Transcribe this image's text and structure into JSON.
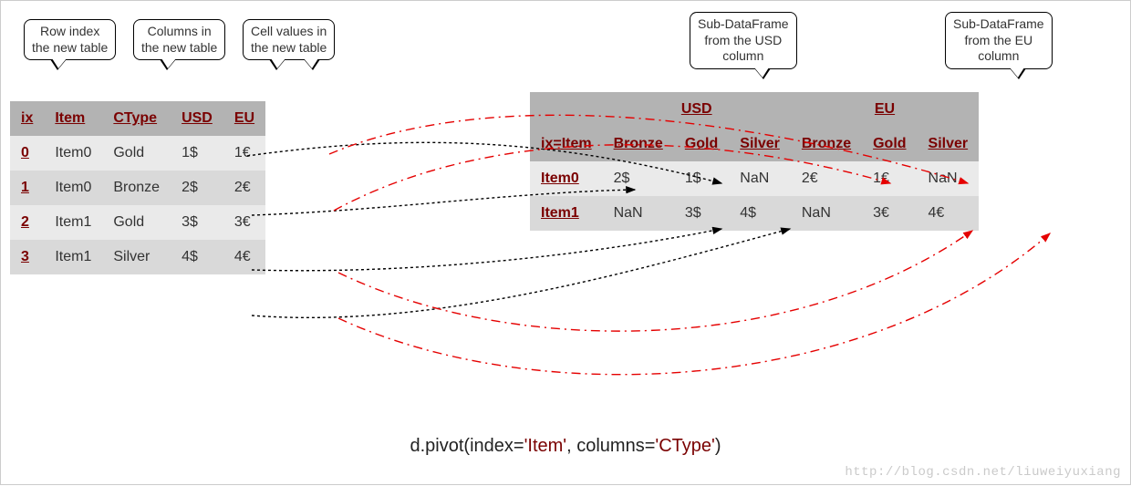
{
  "callouts": {
    "rowIndex": "Row index\nthe new table",
    "columns": "Columns in\nthe new table",
    "cellValues": "Cell values in\nthe new table",
    "subUSD": "Sub-DataFrame\nfrom the USD\ncolumn",
    "subEU": "Sub-DataFrame\nfrom the EU\ncolumn"
  },
  "leftTable": {
    "headers": [
      "ix",
      "Item",
      "CType",
      "USD",
      "EU"
    ],
    "rows": [
      {
        "ix": "0",
        "item": "Item0",
        "ctype": "Gold",
        "usd": "1$",
        "eu": "1€"
      },
      {
        "ix": "1",
        "item": "Item0",
        "ctype": "Bronze",
        "usd": "2$",
        "eu": "2€"
      },
      {
        "ix": "2",
        "item": "Item1",
        "ctype": "Gold",
        "usd": "3$",
        "eu": "3€"
      },
      {
        "ix": "3",
        "item": "Item1",
        "ctype": "Silver",
        "usd": "4$",
        "eu": "4€"
      }
    ]
  },
  "rightTable": {
    "topGroups": [
      "USD",
      "EU"
    ],
    "subHeaders": [
      "Bronze",
      "Gold",
      "Silver"
    ],
    "indexHeader": "ix=Item",
    "rows": [
      {
        "index": "Item0",
        "usd": {
          "bronze": "2$",
          "gold": "1$",
          "silver": "NaN"
        },
        "eu": {
          "bronze": "2€",
          "gold": "1€",
          "silver": "NaN"
        }
      },
      {
        "index": "Item1",
        "usd": {
          "bronze": "NaN",
          "gold": "3$",
          "silver": "4$"
        },
        "eu": {
          "bronze": "NaN",
          "gold": "3€",
          "silver": "4€"
        }
      }
    ]
  },
  "code": {
    "prefix": "d.pivot(index=",
    "arg1": "'Item'",
    "mid": ", columns=",
    "arg2": "'CType'",
    "suffix": ")"
  },
  "watermark": "http://blog.csdn.net/liuweiyuxiang"
}
